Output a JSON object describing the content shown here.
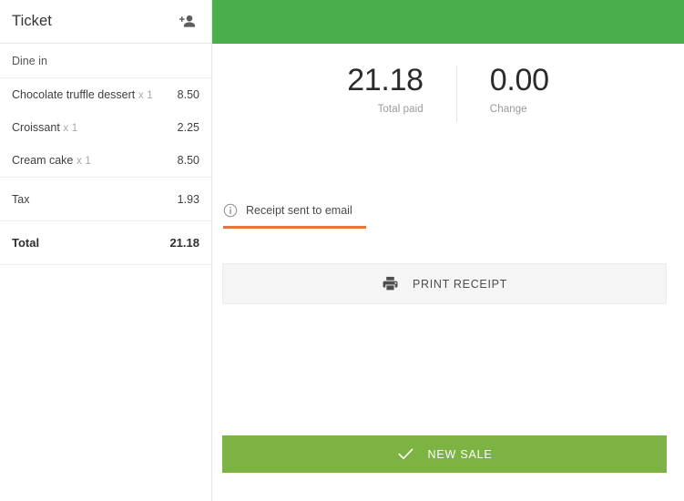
{
  "ticket": {
    "title": "Ticket",
    "add_person_icon": "add-person-icon",
    "order_type": "Dine in",
    "items": [
      {
        "name": "Chocolate truffle dessert",
        "qty": "x 1",
        "price": "8.50"
      },
      {
        "name": "Croissant",
        "qty": "x 1",
        "price": "2.25"
      },
      {
        "name": "Cream cake",
        "qty": "x 1",
        "price": "8.50"
      }
    ],
    "tax_label": "Tax",
    "tax_value": "1.93",
    "total_label": "Total",
    "total_value": "21.18"
  },
  "payment": {
    "total_paid_amount": "21.18",
    "total_paid_label": "Total paid",
    "change_amount": "0.00",
    "change_label": "Change",
    "receipt_status": "Receipt sent to email",
    "receipt_info_icon": "info-icon",
    "print_receipt_label": "PRINT RECEIPT",
    "print_icon": "printer-icon",
    "new_sale_label": "NEW SALE",
    "check_icon": "check-icon"
  },
  "colors": {
    "header_green": "#4aaf4b",
    "new_sale_green": "#7cb342",
    "accent_orange": "#e8763a",
    "print_button_bg": "#f5f5f5"
  }
}
